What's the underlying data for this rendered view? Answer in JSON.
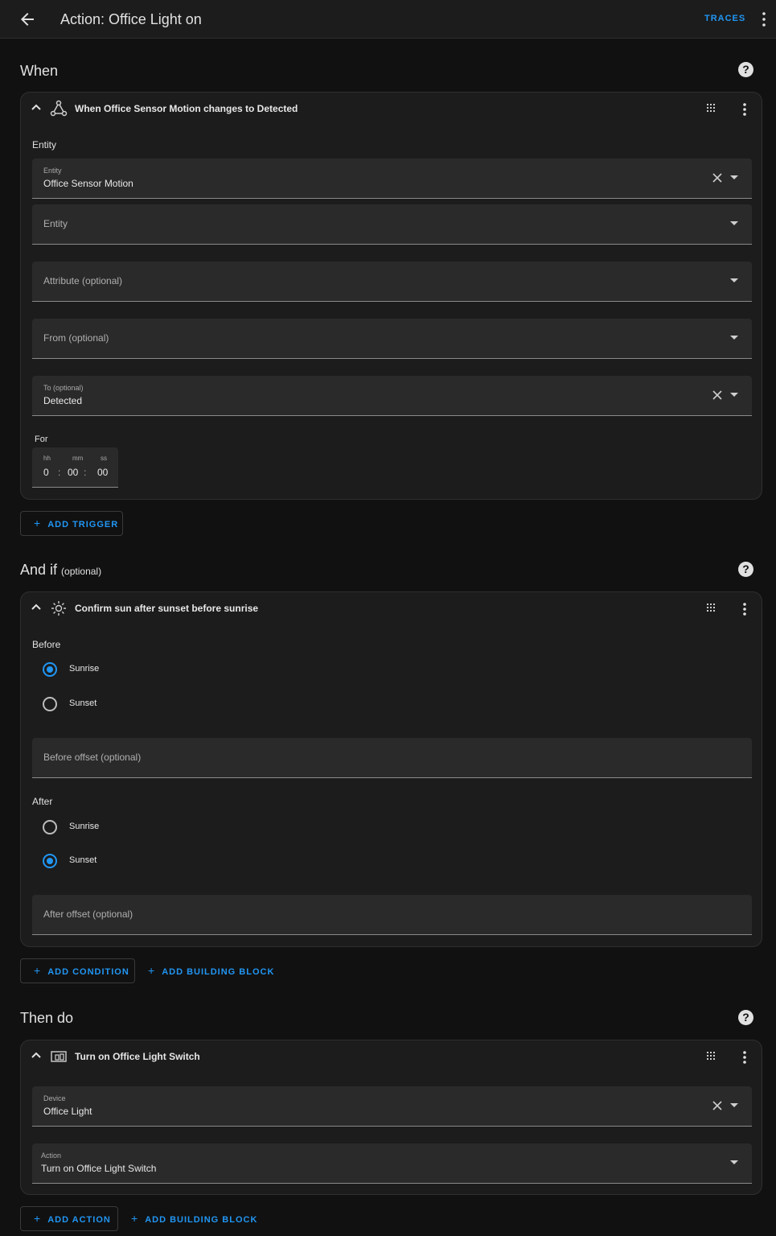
{
  "header": {
    "title": "Action: Office Light on",
    "traces_label": "TRACES"
  },
  "when": {
    "title": "When",
    "card_title": "When Office Sensor Motion changes to Detected",
    "entity_section_label": "Entity",
    "entity_field": {
      "label": "Entity",
      "value": "Office Sensor Motion"
    },
    "entity_empty_placeholder": "Entity",
    "attribute_placeholder": "Attribute (optional)",
    "from_placeholder": "From (optional)",
    "to_field": {
      "label": "To (optional)",
      "value": "Detected"
    },
    "for_label": "For",
    "duration": {
      "hh_label": "hh",
      "mm_label": "mm",
      "ss_label": "ss",
      "hh": "0",
      "mm": "00",
      "ss": "00"
    },
    "add_label": "ADD TRIGGER"
  },
  "and_if": {
    "title": "And if",
    "title_suffix": "(optional)",
    "card_title": "Confirm sun after sunset before sunrise",
    "before_label": "Before",
    "before_options": [
      "Sunrise",
      "Sunset"
    ],
    "before_selected": "Sunrise",
    "before_offset_placeholder": "Before offset (optional)",
    "after_label": "After",
    "after_options": [
      "Sunrise",
      "Sunset"
    ],
    "after_selected": "Sunset",
    "after_offset_placeholder": "After offset (optional)",
    "add_label": "ADD CONDITION",
    "add_block_label": "ADD BUILDING BLOCK"
  },
  "then_do": {
    "title": "Then do",
    "card_title": "Turn on Office Light Switch",
    "device_field": {
      "label": "Device",
      "value": "Office Light"
    },
    "action_field": {
      "label": "Action",
      "value": "Turn on Office Light Switch"
    },
    "add_label": "ADD ACTION",
    "add_block_label": "ADD BUILDING BLOCK"
  },
  "icons": {
    "back": "arrow-left-icon",
    "menu": "dots-vertical-icon",
    "help": "help-circle-icon",
    "trigger": "state-change-icon",
    "condition": "sun-icon",
    "action": "device-icon",
    "drag": "drag-handle-icon",
    "chevron": "chevron-up-icon",
    "clear": "close-icon",
    "caret": "menu-down-icon",
    "plus": "plus-icon"
  },
  "colors": {
    "accent": "#2196f3",
    "background": "#111111",
    "card": "#1c1c1c",
    "field": "#2a2a2a"
  }
}
